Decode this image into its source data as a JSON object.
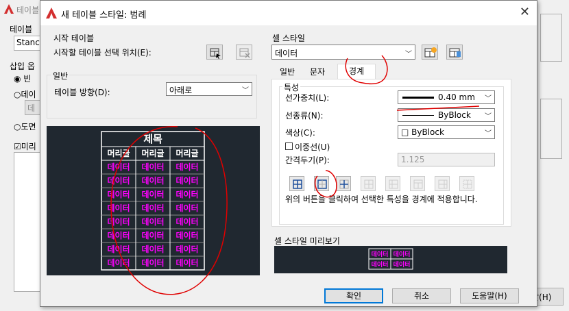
{
  "background": {
    "title_partial": "테이블",
    "label_style_partial": "테이블",
    "style_value_partial": "Stanc",
    "label_insert_partial": "삽입 옵",
    "radio_empty_partial": "빈",
    "radio_data_partial": "데이",
    "button_data_partial": "데",
    "radio_drawing_partial": "도면",
    "checkbox_preview_partial": "미리",
    "button_help_partial": "말(H)"
  },
  "dialog": {
    "title": "새 테이블 스타일: 범례",
    "close": "✕"
  },
  "start_table": {
    "group": "시작 테이블",
    "label": "시작할 테이블 선택 위치(E):"
  },
  "general": {
    "group": "일반",
    "direction_label": "테이블 방향(D):",
    "direction_value": "아래로"
  },
  "preview_table": {
    "title": "제목",
    "headers": [
      "머리글",
      "머리글",
      "머리글"
    ],
    "rows": [
      [
        "데이터",
        "데이터",
        "데이터"
      ],
      [
        "데이터",
        "데이터",
        "데이터"
      ],
      [
        "데이터",
        "데이터",
        "데이터"
      ],
      [
        "데이터",
        "데이터",
        "데이터"
      ],
      [
        "데이터",
        "데이터",
        "데이터"
      ],
      [
        "데이터",
        "데이터",
        "데이터"
      ],
      [
        "데이터",
        "데이터",
        "데이터"
      ],
      [
        "데이터",
        "데이터",
        "데이터"
      ]
    ]
  },
  "cell_style": {
    "group": "셀 스타일",
    "value": "데이터",
    "tabs": [
      "일반",
      "문자",
      "경계"
    ],
    "active_tab": "경계"
  },
  "properties": {
    "group": "특성",
    "lineweight_label": "선가중치(L):",
    "lineweight_value": "0.40 mm",
    "linetype_label": "선종류(N):",
    "linetype_value": "ByBlock",
    "color_label": "색상(C):",
    "color_value": "□ ByBlock",
    "double_line_label": "이중선(U)",
    "spacing_label": "간격두기(P):",
    "spacing_value": "1.125",
    "instruction": "위의 버튼을 클릭하여 선택한 특성을 경계에 적용합니다."
  },
  "cell_preview": {
    "group": "셀 스타일 미리보기",
    "cells": [
      "데이터",
      "데이터",
      "데이터",
      "데이터"
    ]
  },
  "buttons": {
    "ok": "확인",
    "cancel": "취소",
    "help": "도움말(H)"
  },
  "colors": {
    "magenta": "#ff00ff",
    "preview_bg": "#202830",
    "annotation_red": "#e00000",
    "accent": "#0078d7",
    "logo_red": "#d32f2f"
  }
}
